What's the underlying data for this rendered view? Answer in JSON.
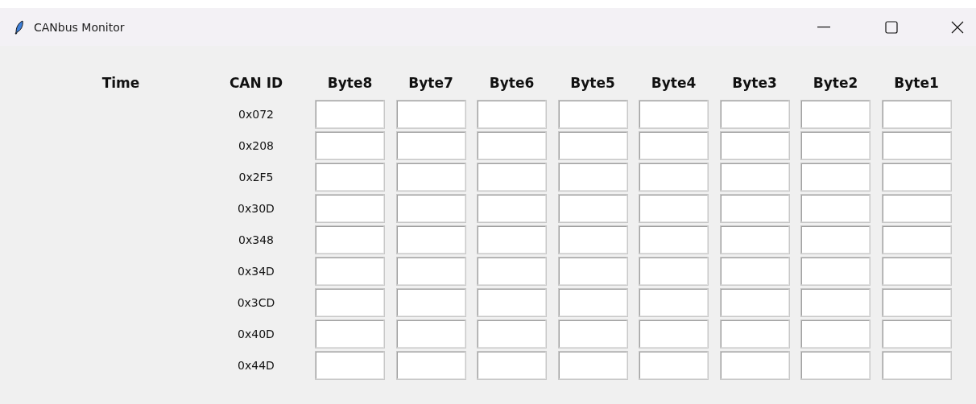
{
  "window": {
    "title": "CANbus Monitor"
  },
  "table": {
    "columns": [
      "Time",
      "CAN ID",
      "Byte8",
      "Byte7",
      "Byte6",
      "Byte5",
      "Byte4",
      "Byte3",
      "Byte2",
      "Byte1"
    ],
    "rows": [
      {
        "can_id": "0x072"
      },
      {
        "can_id": "0x208"
      },
      {
        "can_id": "0x2F5"
      },
      {
        "can_id": "0x30D"
      },
      {
        "can_id": "0x348"
      },
      {
        "can_id": "0x34D"
      },
      {
        "can_id": "0x3CD"
      },
      {
        "can_id": "0x40D"
      },
      {
        "can_id": "0x44D"
      }
    ]
  }
}
